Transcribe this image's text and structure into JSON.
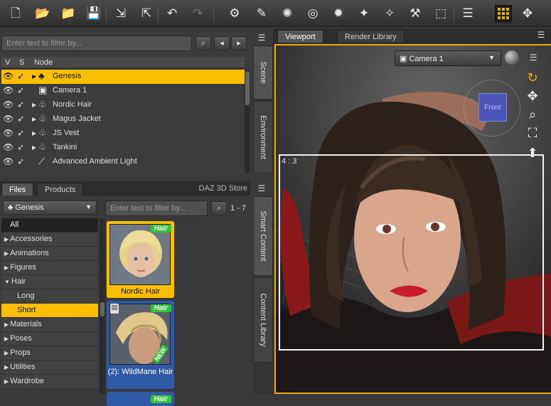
{
  "toolbar": {
    "icons": [
      "new-file-icon",
      "open-folder-icon",
      "merge-folder-icon",
      "save-icon",
      "import-icon",
      "export-icon",
      "undo-icon",
      "redo-icon",
      "figure-setup-icon",
      "joint-editor-icon",
      "spot-render-icon",
      "node-weight-icon",
      "surface-selection-icon",
      "region-navigator-icon",
      "geometry-editor-icon",
      "transform-icon",
      "align-icon",
      "aux-viewport-icon",
      "universal-tool-icon"
    ]
  },
  "scene": {
    "filter_placeholder": "Enter text to filter by...",
    "col_v": "V",
    "col_s": "S",
    "col_node": "Node",
    "nodes": [
      {
        "label": "Genesis",
        "selected": true,
        "expandable": true
      },
      {
        "label": "Camera 1",
        "selected": false,
        "expandable": false
      },
      {
        "label": "Nordic Hair",
        "selected": false,
        "expandable": true
      },
      {
        "label": "Magus Jacket",
        "selected": false,
        "expandable": true
      },
      {
        "label": "JS Vest",
        "selected": false,
        "expandable": true
      },
      {
        "label": "Tankini",
        "selected": false,
        "expandable": true
      },
      {
        "label": "Advanced Ambient Light",
        "selected": false,
        "expandable": false
      }
    ]
  },
  "side_tabs": {
    "scene": "Scene",
    "environment": "Environment",
    "smart_content": "Smart Content",
    "content_library": "Content Library"
  },
  "content": {
    "tab_files": "Files",
    "tab_products": "Products",
    "tab_store": "DAZ 3D Store",
    "figure_selector": "Genesis",
    "filter_placeholder": "Enter text to filter by...",
    "count": "1 - 7",
    "categories": [
      {
        "label": "All",
        "kind": "all"
      },
      {
        "label": "Accessories",
        "kind": "closed"
      },
      {
        "label": "Animations",
        "kind": "closed"
      },
      {
        "label": "Figures",
        "kind": "closed"
      },
      {
        "label": "Hair",
        "kind": "open"
      },
      {
        "label": "Long",
        "kind": "sub"
      },
      {
        "label": "Short",
        "kind": "sub-selected"
      },
      {
        "label": "Materials",
        "kind": "closed"
      },
      {
        "label": "Poses",
        "kind": "closed"
      },
      {
        "label": "Props",
        "kind": "closed"
      },
      {
        "label": "Utilities",
        "kind": "closed"
      },
      {
        "label": "Wardrobe",
        "kind": "closed"
      }
    ],
    "items": [
      {
        "name": "Nordic Hair",
        "tag": "Hair"
      },
      {
        "name": "(2): WildMane Hair",
        "tag": "Hair",
        "badge": "NEW"
      },
      {
        "name": "",
        "tag": "Hair"
      }
    ]
  },
  "viewport": {
    "tab_viewport": "Viewport",
    "tab_render_library": "Render Library",
    "camera": "Camera 1",
    "aspect_label": "4 : 3",
    "cube_face": "Front"
  },
  "colors": {
    "accent": "#fbbf00",
    "panel": "#3a3a3a",
    "hair_tag": "#31c531"
  }
}
